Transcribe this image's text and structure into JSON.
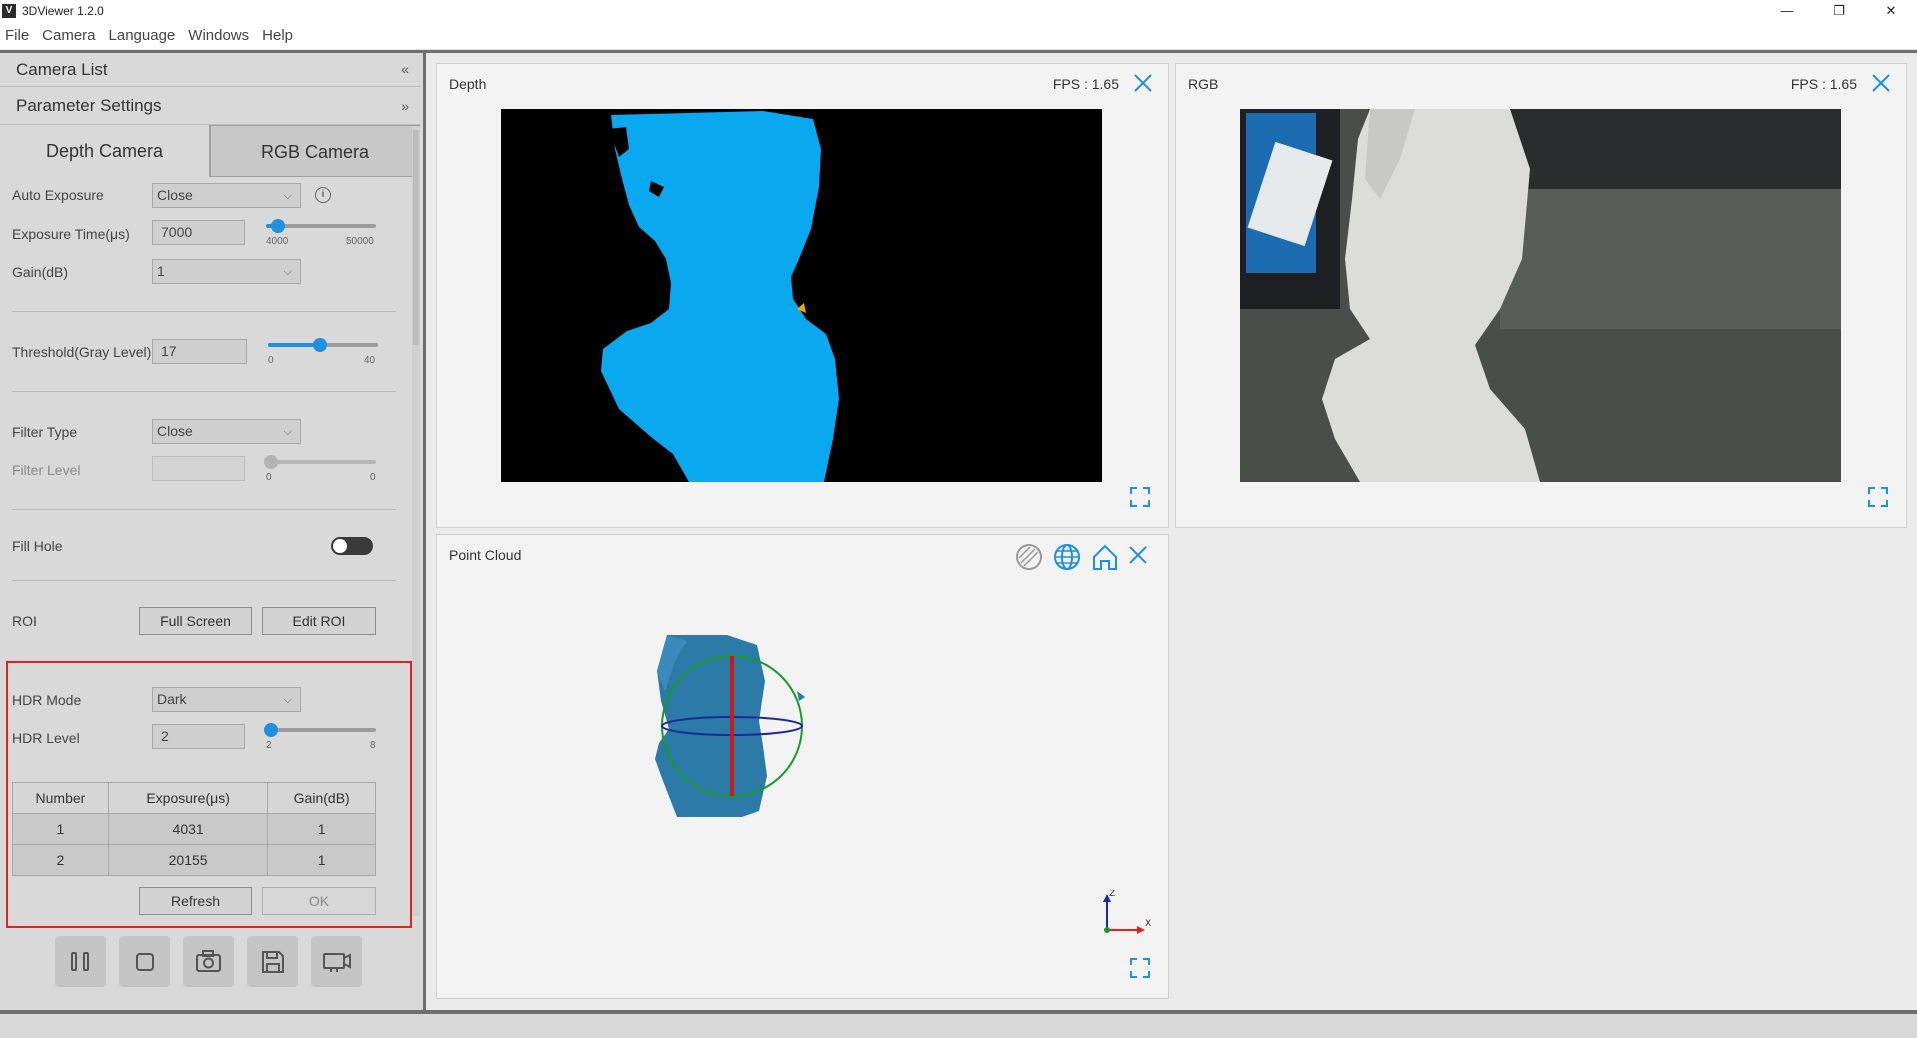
{
  "window": {
    "app_icon": "V",
    "title": "3DViewer 1.2.0",
    "controls": [
      "—",
      "❐",
      "✕"
    ]
  },
  "menu": [
    "File",
    "Camera",
    "Language",
    "Windows",
    "Help"
  ],
  "left_panel": {
    "camera_list_label": "Camera List",
    "param_settings_label": "Parameter Settings",
    "tabs": [
      "Depth Camera",
      "RGB Camera"
    ],
    "active_tab": "Depth Camera",
    "auto_exposure": {
      "label": "Auto Exposure",
      "value": "Close"
    },
    "exposure_time": {
      "label": "Exposure Time(μs)",
      "value": "7000",
      "min": "4000",
      "max": "50000",
      "fraction": 0.065
    },
    "gain": {
      "label": "Gain(dB)",
      "value": "1"
    },
    "threshold": {
      "label": "Threshold(Gray Level)",
      "value": "17",
      "min": "0",
      "max": "40",
      "fraction": 0.425
    },
    "filter_type": {
      "label": "Filter Type",
      "value": "Close"
    },
    "filter_level": {
      "label": "Filter Level",
      "value": "",
      "min": "0",
      "max": "0",
      "fraction": 0
    },
    "fill_hole": {
      "label": "Fill Hole",
      "on": false
    },
    "roi": {
      "label": "ROI",
      "full_screen": "Full Screen",
      "edit_roi": "Edit ROI"
    },
    "hdr_mode": {
      "label": "HDR Mode",
      "value": "Dark"
    },
    "hdr_level": {
      "label": "HDR Level",
      "value": "2",
      "min": "2",
      "max": "8",
      "fraction": 0
    },
    "hdr_table": {
      "headers": [
        "Number",
        "Exposure(μs)",
        "Gain(dB)"
      ],
      "rows": [
        [
          "1",
          "4031",
          "1"
        ],
        [
          "2",
          "20155",
          "1"
        ]
      ]
    },
    "refresh": "Refresh",
    "ok": "OK",
    "toolbar": [
      "pause-icon",
      "stop-icon",
      "capture-icon",
      "save-icon",
      "record-icon"
    ]
  },
  "viewports": {
    "depth": {
      "title": "Depth",
      "fps": "FPS : 1.65"
    },
    "rgb": {
      "title": "RGB",
      "fps": "FPS : 1.65"
    },
    "point_cloud": {
      "title": "Point Cloud"
    }
  },
  "colors": {
    "accent": "#1f8fe0",
    "depth_blue": "#0aa8ef",
    "highlight_red": "#e12020"
  }
}
